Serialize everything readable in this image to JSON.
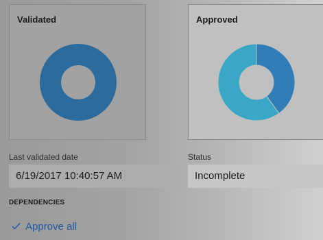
{
  "cards": [
    {
      "title": "Validated",
      "donut": {
        "segments": [
          {
            "value": 1,
            "color": "#2d6b9c"
          }
        ]
      }
    },
    {
      "title": "Approved",
      "donut": {
        "segments": [
          {
            "value": 0.4,
            "color": "#2f7cb6"
          },
          {
            "value": 0.6,
            "color": "#3aa7c7"
          }
        ]
      }
    }
  ],
  "fields": {
    "last_validated_label": "Last validated date",
    "last_validated_value": "6/19/2017 10:40:57 AM",
    "status_label": "Status",
    "status_value": "Incomplete"
  },
  "dependencies": {
    "heading": "DEPENDENCIES",
    "approve_all_label": "Approve all",
    "approve_icon": "checkmark-icon",
    "link_color": "#1d5a9e"
  }
}
